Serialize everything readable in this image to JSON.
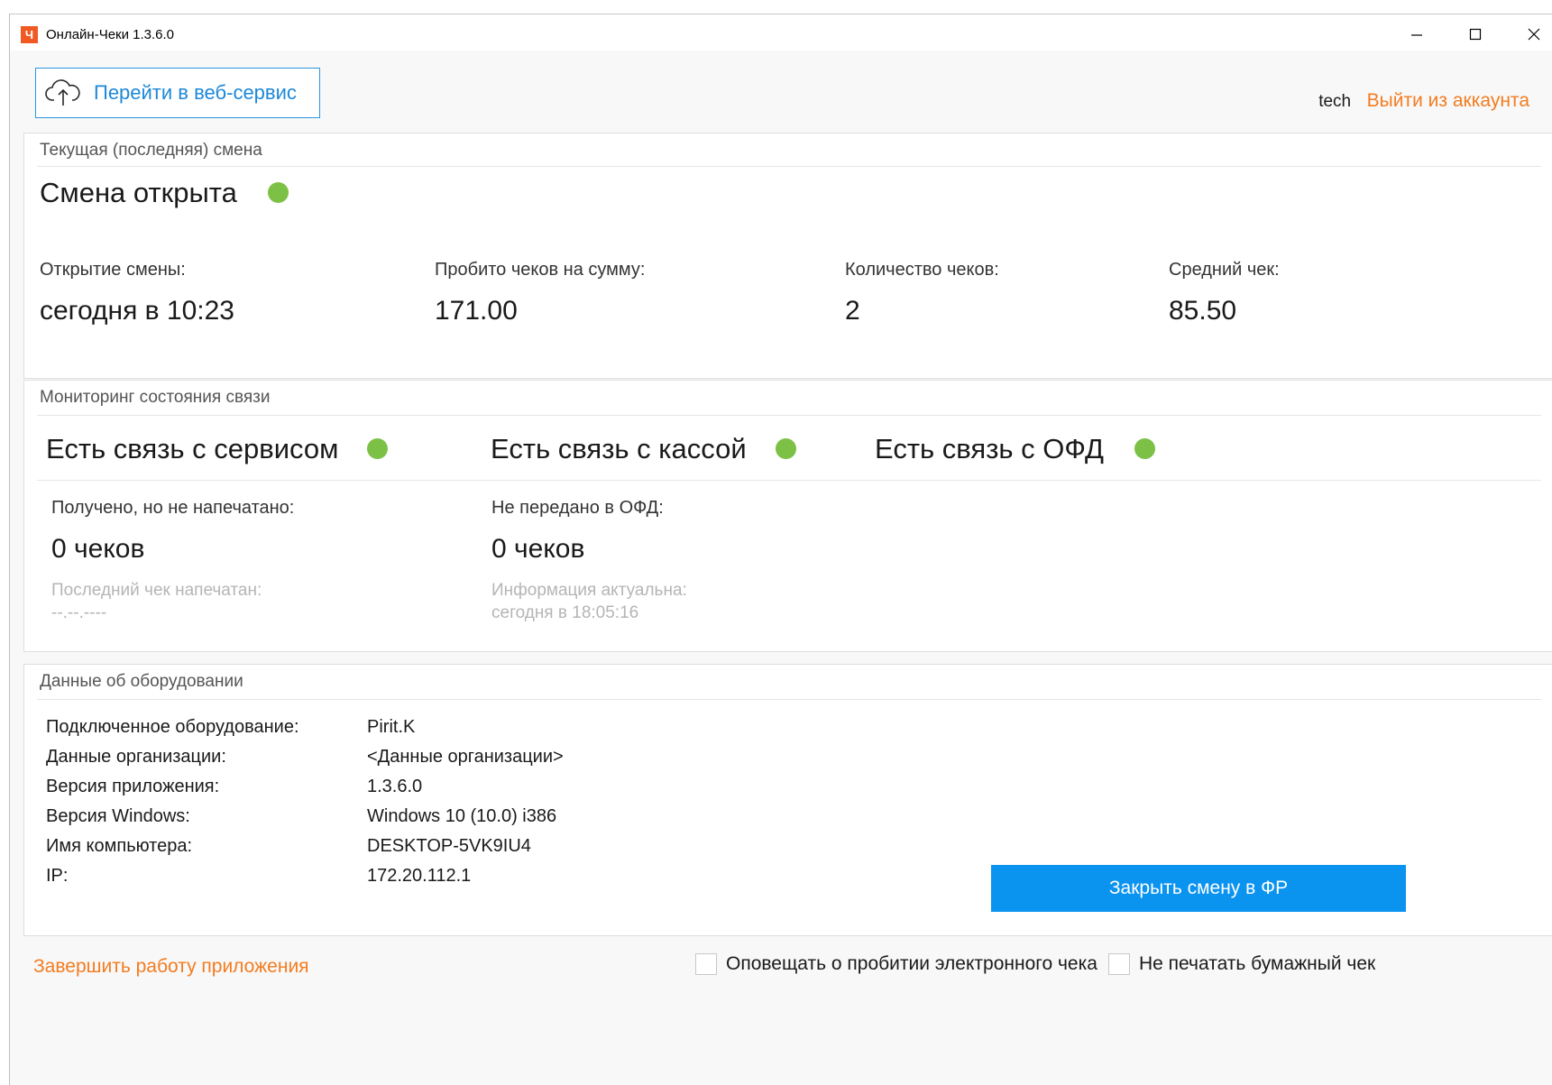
{
  "window": {
    "app_icon_letter": "Ч",
    "title": "Онлайн-Чеки 1.3.6.0"
  },
  "header": {
    "web_service_button": "Перейти в веб-сервис",
    "username": "tech",
    "logout_link": "Выйти из аккаунта"
  },
  "shift": {
    "section_title": "Текущая (последняя) смена",
    "status": "Смена открыта",
    "status_color": "#7cc146",
    "stats": [
      {
        "label": "Открытие смены:",
        "value": "сегодня в 10:23"
      },
      {
        "label": "Пробито чеков на сумму:",
        "value": "171.00"
      },
      {
        "label": "Количество чеков:",
        "value": "2"
      },
      {
        "label": "Средний чек:",
        "value": "85.50"
      }
    ]
  },
  "monitoring": {
    "section_title": "Мониторинг состояния связи",
    "connections": [
      {
        "label": "Есть связь с сервисом",
        "status_color": "#7cc146"
      },
      {
        "label": "Есть связь с кассой",
        "status_color": "#7cc146"
      },
      {
        "label": "Есть связь с ОФД",
        "status_color": "#7cc146"
      }
    ],
    "unprinted": {
      "label": "Получено, но не напечатано:",
      "value": "0 чеков",
      "sub_label": "Последний чек напечатан:",
      "sub_value": "--.--.----"
    },
    "not_sent": {
      "label": "Не передано в ОФД:",
      "value": "0 чеков",
      "sub_label": "Информация актуальна:",
      "sub_value": "сегодня в 18:05:16"
    }
  },
  "equipment": {
    "section_title": "Данные об оборудовании",
    "rows": [
      {
        "label": "Подключенное оборудование:",
        "value": "Pirit.K"
      },
      {
        "label": "Данные организации:",
        "value": "<Данные организации>"
      },
      {
        "label": "Версия приложения:",
        "value": "1.3.6.0"
      },
      {
        "label": "Версия Windows:",
        "value": "Windows 10 (10.0) i386"
      },
      {
        "label": "Имя компьютера:",
        "value": "DESKTOP-5VK9IU4"
      },
      {
        "label": "IP:",
        "value": "172.20.112.1"
      }
    ],
    "close_shift_button": "Закрыть смену в ФР",
    "button_color": "#0b93f0"
  },
  "footer": {
    "exit_link": "Завершить работу приложения",
    "notify_checkbox": {
      "label": "Оповещать о пробитии электронного чека",
      "checked": false
    },
    "no_paper_checkbox": {
      "label": "Не печатать бумажный чек",
      "checked": false
    }
  },
  "colors": {
    "accent_orange": "#f47c20",
    "accent_blue": "#1e88d8"
  }
}
